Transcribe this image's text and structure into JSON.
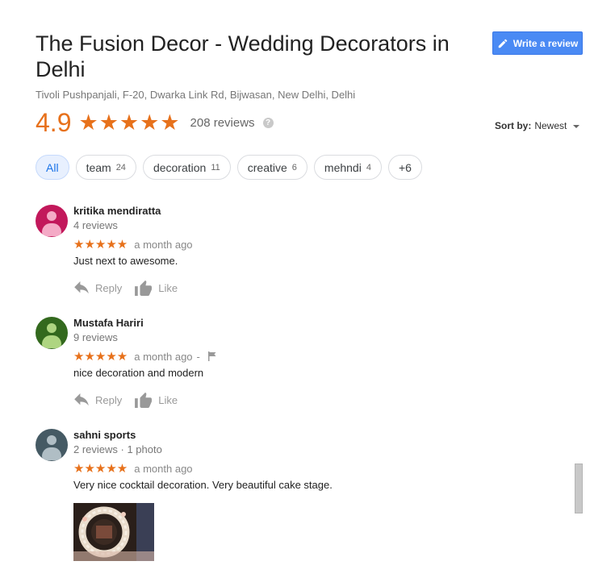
{
  "header": {
    "title": "The Fusion Decor - Wedding Decorators in Delhi",
    "address": "Tivoli Pushpanjali, F-20, Dwarka Link Rd, Bijwasan, New Delhi, Delhi",
    "write_review_label": "Write a review",
    "write_review_icon": "pencil-icon"
  },
  "summary": {
    "rating": "4.9",
    "stars": "★★★★★",
    "review_count": "208 reviews",
    "help_icon": "help-icon",
    "help_glyph": "?",
    "accent_color": "#e7711b"
  },
  "sort": {
    "label": "Sort by:",
    "value": "Newest"
  },
  "chips": [
    {
      "label": "All",
      "count": "",
      "active": true
    },
    {
      "label": "team",
      "count": "24"
    },
    {
      "label": "decoration",
      "count": "11"
    },
    {
      "label": "creative",
      "count": "6"
    },
    {
      "label": "mehndi",
      "count": "4"
    },
    {
      "label": "+6",
      "count": ""
    }
  ],
  "reviews": [
    {
      "name": "kritika mendiratta",
      "meta": "4 reviews",
      "stars": "★★★★★",
      "time": "a month ago",
      "text": "Just next to awesome.",
      "reply_label": "Reply",
      "like_label": "Like",
      "avatar_color": "#c2185b"
    },
    {
      "name": "Mustafa Hariri",
      "meta": "9 reviews",
      "stars": "★★★★★",
      "time": "a month ago",
      "separator": "-",
      "text": "nice decoration and modern",
      "reply_label": "Reply",
      "like_label": "Like",
      "avatar_color": "#33691e"
    },
    {
      "name": "sahni sports",
      "meta": "2 reviews · 1 photo",
      "stars": "★★★★★",
      "time": "a month ago",
      "text": "Very nice cocktail decoration. Very beautiful cake stage.",
      "avatar_color": "#455a64"
    }
  ]
}
